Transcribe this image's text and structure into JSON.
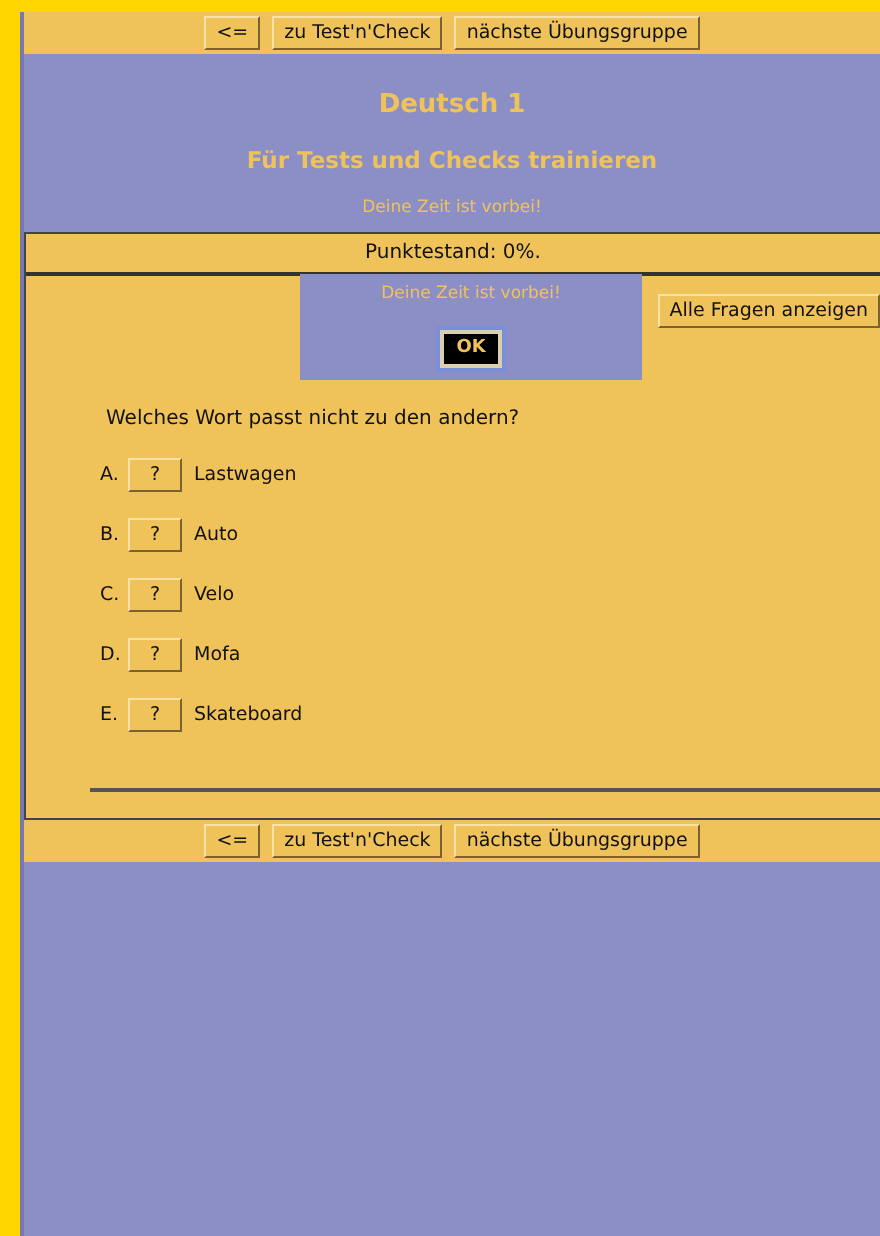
{
  "top_nav": [
    "<=",
    "zu Test'n'Check",
    "nächste Übungsgruppe"
  ],
  "title": "Deutsch 1",
  "subtitle": "Für Tests und Checks trainieren",
  "notice": "Deine Zeit ist vorbei!",
  "score": "Punktestand: 0%.",
  "dialog": {
    "message": "Deine Zeit ist vorbei!",
    "button": "OK"
  },
  "show_all_button": "Alle Fragen anzeigen",
  "question": "Welches Wort passt nicht zu den andern?",
  "answers": [
    {
      "letter": "A.",
      "button": "?",
      "text": "Lastwagen"
    },
    {
      "letter": "B.",
      "button": "?",
      "text": "Auto"
    },
    {
      "letter": "C.",
      "button": "?",
      "text": "Velo"
    },
    {
      "letter": "D.",
      "button": "?",
      "text": "Mofa"
    },
    {
      "letter": "E.",
      "button": "?",
      "text": "Skateboard"
    }
  ],
  "bottom_nav": [
    "<=",
    "zu Test'n'Check",
    "nächste Übungsgruppe"
  ]
}
